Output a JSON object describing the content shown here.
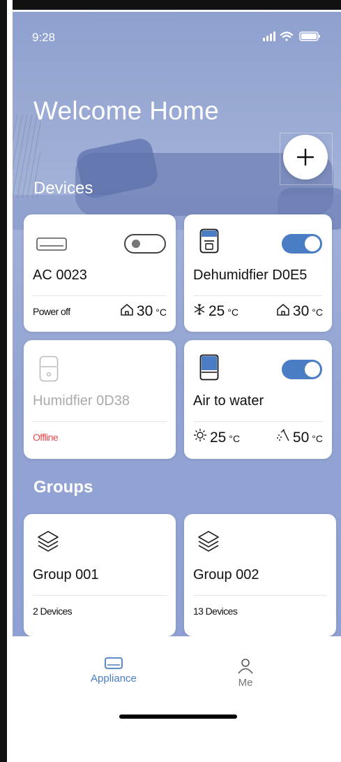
{
  "status_bar": {
    "time": "9:28"
  },
  "header": {
    "title": "Welcome Home",
    "add_label": "+"
  },
  "sections": {
    "devices": "Devices",
    "groups": "Groups"
  },
  "devices": [
    {
      "name": "AC 0023",
      "status": "Power off",
      "indoor_temp": "30",
      "unit": "°C",
      "switch": "off",
      "icon": "air-conditioner-icon"
    },
    {
      "name": "Dehumidfier D0E5",
      "cool_temp": "25",
      "indoor_temp": "30",
      "unit": "°C",
      "switch": "on",
      "icon": "dehumidifier-icon"
    },
    {
      "name": "Humidfier 0D38",
      "status": "Offline",
      "icon": "humidifier-icon"
    },
    {
      "name": "Air to water",
      "sun_temp": "25",
      "water_temp": "50",
      "unit": "°C",
      "switch": "on",
      "icon": "water-heater-icon"
    }
  ],
  "groups": [
    {
      "name": "Group 001",
      "count": "2 Devices"
    },
    {
      "name": "Group 002",
      "count": "13 Devices"
    }
  ],
  "nav": {
    "appliance": "Appliance",
    "me": "Me"
  },
  "colors": {
    "accent": "#4a7dc4",
    "offline": "#e84b4b",
    "hero": "#93a4d3"
  }
}
